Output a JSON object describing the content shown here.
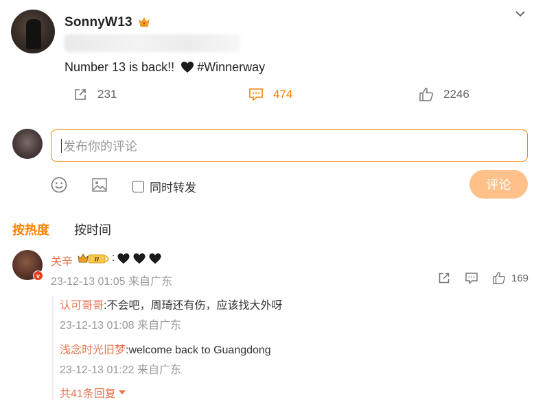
{
  "post": {
    "username": "SonnyW13",
    "text_before": "Number 13 is back!! ",
    "hashtag": "#Winnerway",
    "stats": {
      "repost_count": "231",
      "comment_count": "474",
      "like_count": "2246"
    }
  },
  "composer": {
    "placeholder": "发布你的评论",
    "repost_checkbox_label": "同时转发",
    "submit_label": "评论"
  },
  "sort": {
    "hot_label": "按热度",
    "time_label": "按时间"
  },
  "comment": {
    "author": "关辛",
    "rank_label": "II",
    "text_prefix": ":",
    "meta": "23-12-13 01:05 来自广东",
    "like_count": "169",
    "replies": [
      {
        "author": "认可哥哥",
        "text": ":不会吧，周琦还有伤，应该找大外呀",
        "meta": "23-12-13 01:08 来自广东"
      },
      {
        "author": "浅念时光旧梦",
        "text": ":welcome back to Guangdong",
        "meta": "23-12-13 01:22 来自广东"
      }
    ],
    "more_replies_label": "共41条回复"
  },
  "colors": {
    "accent": "#ff8200",
    "name_link": "#eb7350",
    "submit_disabled": "#ffc089",
    "muted_text": "#999999"
  },
  "icons": [
    "crown-icon",
    "chevron-down-icon",
    "black-heart-icon",
    "repost-icon",
    "comment-icon",
    "like-icon",
    "emoji-icon",
    "image-icon",
    "verified-icon"
  ]
}
